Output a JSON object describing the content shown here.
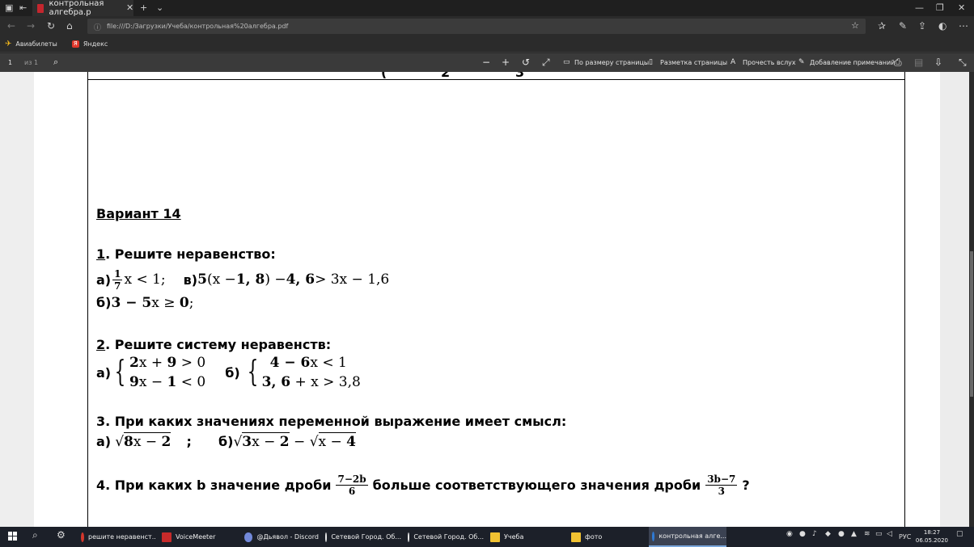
{
  "browser": {
    "tab_title": "контрольная алгебра.p",
    "url": "file:///D:/Загрузки/Учеба/контрольная%20алгебра.pdf",
    "favorites": [
      "Авиабилеты",
      "Яндекс"
    ]
  },
  "pdf_toolbar": {
    "page_number": "1",
    "page_total": "из 1",
    "fit_page": "По размеру страницы",
    "page_layout": "Разметка страницы",
    "read_aloud": "Прочесть вслух",
    "add_notes": "Добавление примечаний"
  },
  "document": {
    "variant_title": "Вариант 14",
    "task1": {
      "number": "1",
      "title": ". Решите неравенство:",
      "a_label": "а)",
      "a_num": "1",
      "a_den": "7",
      "a_rest": "x < 1;",
      "v_label": "в)",
      "v_expr_bold1": "5",
      "v_expr1": "(x − ",
      "v_expr_bold2": "1, 8",
      "v_expr2": ") − ",
      "v_expr_bold3": "4, 6",
      "v_expr3": " > 3x − 1,6",
      "b_label": "б)",
      "b_expr_bold1": "3 − 5",
      "b_expr1": "x ≥ ",
      "b_expr_bold2": "0",
      "b_expr2": ";"
    },
    "task2": {
      "number": "2",
      "title": ". Решите систему неравенств:",
      "a_label": "а)",
      "a_line1_bold": "2",
      "a_line1": "x + ",
      "a_line1_bold2": "9",
      "a_line1_end": " > 0",
      "a_line2_bold": "9",
      "a_line2": "x − ",
      "a_line2_bold2": "1",
      "a_line2_end": " < 0",
      "b_label": "б)",
      "b_line1_bold": "4 − 6",
      "b_line1": "x < 1",
      "b_line2_bold": "3, 6",
      "b_line2": " + x > 3,8"
    },
    "task3": {
      "title": "3. При каких значениях переменной выражение имеет смысл:",
      "a_label": "а)",
      "a_sqrt_bold": "8",
      "a_sqrt": "x − ",
      "a_sqrt_bold2": "2",
      "sep": ";",
      "b_label": "б)",
      "b_sqrt1_bold": "3",
      "b_sqrt1": "x − ",
      "b_sqrt1_bold2": "2",
      "minus": " − ",
      "b_sqrt2": "x − ",
      "b_sqrt2_bold": "4"
    },
    "task4": {
      "text1": "4. При каких b значение дроби",
      "frac1_num": "7−2b",
      "frac1_den": "6",
      "text2": "больше соответствующего значения дроби",
      "frac2_num": "3b−7",
      "frac2_den": "3",
      "text3": "?"
    }
  },
  "taskbar": {
    "items": [
      {
        "label": "решите неравенст...",
        "color": "#d4372c"
      },
      {
        "label": "VoiceMeeter",
        "color": "#c62a2a"
      },
      {
        "label": "@Дьявол - Discord",
        "color": "#7289da"
      },
      {
        "label": "Сетевой Город. Об...",
        "color": "#e8e8e8"
      },
      {
        "label": "Сетевой Город. Об...",
        "color": "#e8e8e8"
      },
      {
        "label": "Учеба",
        "color": "#f1c232"
      },
      {
        "label": "фото",
        "color": "#f1c232"
      },
      {
        "label": "контрольная алге...",
        "color": "#2f7bd6"
      }
    ],
    "lang": "РУС",
    "time": "18:27",
    "date": "06.05.2020"
  }
}
